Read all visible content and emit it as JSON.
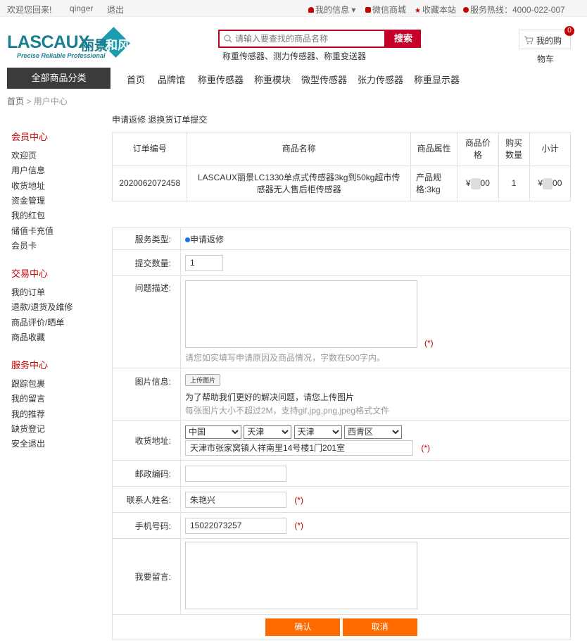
{
  "topbar": {
    "welcome": "欢迎您回来!",
    "username": "qinger",
    "logout": "退出",
    "my_info": "我的信息",
    "wechat_mall": "微信商城",
    "favorite": "收藏本站",
    "hotline": "服务热线：4000-022-007"
  },
  "logo": {
    "brand": "LASCAUX",
    "cn": "丽景",
    "badge": "和风",
    "slogan": "Precise Reliable Professional"
  },
  "search": {
    "placeholder": "请输入要查找的商品名称",
    "button": "搜索",
    "hotwords": "称重传感器、测力传感器、称重变送器"
  },
  "cart": {
    "label_line1": "我的购",
    "label_line2": "物车",
    "count": "0"
  },
  "nav": {
    "all_categories": "全部商品分类",
    "items": [
      "首页",
      "品牌馆",
      "称重传感器",
      "称重模块",
      "微型传感器",
      "张力传感器",
      "称重显示器"
    ]
  },
  "breadcrumb": {
    "home": "首页",
    "sep": ">",
    "current": "用户中心"
  },
  "sidebar": {
    "member_title": "会员中心",
    "member_items": [
      "欢迎页",
      "用户信息",
      "收货地址",
      "资金管理",
      "我的红包",
      "储值卡充值",
      "会员卡"
    ],
    "trade_title": "交易中心",
    "trade_items": [
      "我的订单",
      "退款/退货及维修",
      "商品评价/晒单",
      "商品收藏"
    ],
    "service_title": "服务中心",
    "service_items": [
      "跟踪包裹",
      "我的留言",
      "我的推荐",
      "缺货登记",
      "安全退出"
    ]
  },
  "page_title": "申请返修 退换货订单提交",
  "order_table": {
    "headers": [
      "订单编号",
      "商品名称",
      "商品属性",
      "商品价格",
      "购买数量",
      "小计"
    ],
    "row": {
      "order_no": "2020062072458",
      "name": "LASCAUX丽景LC1330单点式传感器3kg到50kg超市传感器无人售后柜传感器",
      "attr": "产品规格:3kg",
      "price_prefix": "¥",
      "price_suffix": "00",
      "qty": "1",
      "subtotal_prefix": "¥",
      "subtotal_suffix": "00"
    }
  },
  "form": {
    "service_type_label": "服务类型:",
    "service_type_value": "申请返修",
    "qty_label": "提交数量:",
    "qty_value": "1",
    "desc_label": "问题描述:",
    "desc_value": "",
    "desc_required": "(*)",
    "desc_hint": "请您如实填写申请原因及商品情况，字数在500字内。",
    "image_label": "图片信息:",
    "upload_button": "上传图片",
    "image_hint1": "为了帮助我们更好的解决问题，请您上传图片",
    "image_hint2": "每张图片大小不超过2M，支持gif,jpg,png,jpeg格式文件",
    "address_label": "收货地址:",
    "country": "中国",
    "province": "天津",
    "city": "天津",
    "district": "西青区",
    "address_value": "天津市张家窝镇人祥南里14号楼1门201室",
    "address_required": "(*)",
    "zip_label": "邮政编码:",
    "zip_value": "",
    "contact_label": "联系人姓名:",
    "contact_value": "朱艳兴",
    "contact_required": "(*)",
    "phone_label": "手机号码:",
    "phone_value": "15022073257",
    "phone_required": "(*)",
    "message_label": "我要留言:",
    "message_value": "",
    "confirm_button": "确认",
    "cancel_button": "取消"
  },
  "colors": {
    "accent": "#c40000",
    "button": "#ff6a00",
    "brand": "#1b7f8f",
    "dark_nav": "#3b3b3b"
  }
}
